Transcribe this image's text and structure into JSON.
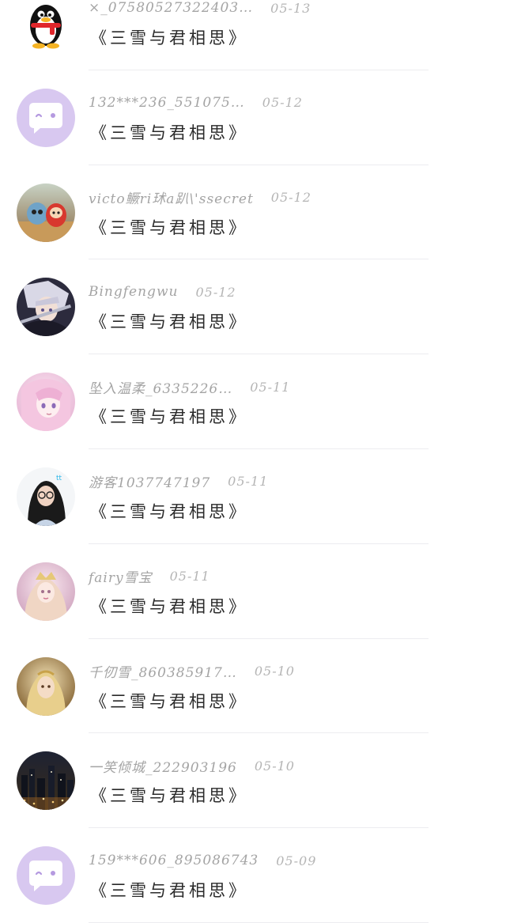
{
  "comments": [
    {
      "avatar": "qq-penguin-avatar",
      "name": "×_07580527322403…",
      "date": "05-13",
      "message": "《三雪与君相思》"
    },
    {
      "avatar": "default-chat-bubble-avatar",
      "name": "132***236_551075…",
      "date": "05-12",
      "message": "《三雪与君相思》"
    },
    {
      "avatar": "toy-figures-photo-avatar",
      "name": "victo鳜ri㺷a趴\\'ssecret",
      "date": "05-12",
      "message": "《三雪与君相思》"
    },
    {
      "avatar": "anime-swordsman-avatar",
      "name": "Bingfengwu",
      "date": "05-12",
      "message": "《三雪与君相思》"
    },
    {
      "avatar": "anime-pink-hair-girl-avatar",
      "name": "坠入温柔_6335226…",
      "date": "05-11",
      "message": "《三雪与君相思》"
    },
    {
      "avatar": "girl-with-glasses-avatar",
      "name": "游客1037747197",
      "date": "05-11",
      "message": "《三雪与君相思》"
    },
    {
      "avatar": "fairy-princess-avatar",
      "name": "fairy雪宝",
      "date": "05-11",
      "message": "《三雪与君相思》"
    },
    {
      "avatar": "golden-portrait-avatar",
      "name": "千仞雪_860385917…",
      "date": "05-10",
      "message": "《三雪与君相思》"
    },
    {
      "avatar": "night-city-avatar",
      "name": "一笑倾城_222903196",
      "date": "05-10",
      "message": "《三雪与君相思》"
    },
    {
      "avatar": "default-chat-bubble-avatar",
      "name": "159***606_895086743",
      "date": "05-09",
      "message": "《三雪与君相思》"
    }
  ]
}
